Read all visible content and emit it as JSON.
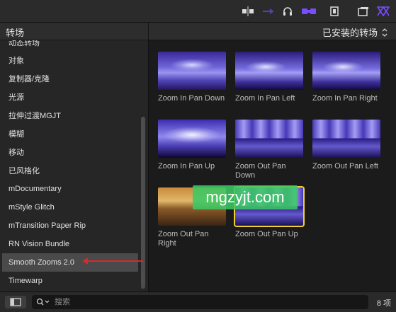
{
  "toolbar": {
    "icons": [
      "split-clip-icon",
      "connect-icon",
      "headphones-icon",
      "transitions-icon",
      "film-icon",
      "window-icon",
      "effects-icon"
    ],
    "accent": "#7a4cff"
  },
  "header": {
    "title": "转场",
    "filter_label": "已安装的转场"
  },
  "sidebar": {
    "items": [
      {
        "label": "动态转场"
      },
      {
        "label": "对象"
      },
      {
        "label": "复制器/克隆"
      },
      {
        "label": "光源"
      },
      {
        "label": "拉伸过渡MGJT"
      },
      {
        "label": "模糊"
      },
      {
        "label": "移动"
      },
      {
        "label": "已风格化"
      },
      {
        "label": "mDocumentary"
      },
      {
        "label": "mStyle Glitch"
      },
      {
        "label": "mTransition Paper Rip"
      },
      {
        "label": "RN Vision Bundle"
      },
      {
        "label": "Smooth Zooms 2.0"
      },
      {
        "label": "Timewarp"
      }
    ],
    "selected_index": 12
  },
  "clips": [
    {
      "label": "Zoom In Pan Down"
    },
    {
      "label": "Zoom In Pan Left"
    },
    {
      "label": "Zoom In Pan Right"
    },
    {
      "label": "Zoom In Pan Up"
    },
    {
      "label": "Zoom Out Pan Down"
    },
    {
      "label": "Zoom Out Pan Left"
    },
    {
      "label": "Zoom Out Pan Right"
    },
    {
      "label": "Zoom Out Pan Up"
    }
  ],
  "watermark": "mgzyjt.com",
  "bottom": {
    "search_placeholder": "搜索",
    "count": "8 项"
  }
}
